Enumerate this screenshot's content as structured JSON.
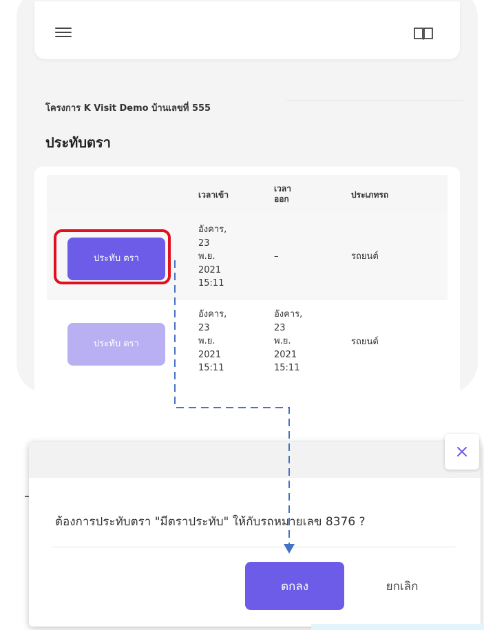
{
  "header": {
    "menu_icon": "hamburger-menu-icon",
    "book_icon": "open-book-icon"
  },
  "project": {
    "title": "โครงการ K Visit Demo บ้านเลขที่ 555"
  },
  "page": {
    "title": "ประทับตรา"
  },
  "table": {
    "columns": [
      "",
      "เวลาเข้า",
      "เวลา ออก",
      "ประเภทรถ"
    ],
    "rows": [
      {
        "action_label": "ประทับ ตรา",
        "enabled": true,
        "time_in": [
          "อังคาร,",
          "23",
          "พ.ย.",
          "2021",
          "15:11"
        ],
        "time_out": "–",
        "vehicle_type": "รถยนต์"
      },
      {
        "action_label": "ประทับ ตรา",
        "enabled": false,
        "time_in": [
          "อังคาร,",
          "23",
          "พ.ย.",
          "2021",
          "15:11"
        ],
        "time_out": [
          "อังคาร,",
          "23",
          "พ.ย.",
          "2021",
          "15:11"
        ],
        "vehicle_type": "รถยนต์"
      }
    ]
  },
  "dialog": {
    "message": "ต้องการประทับตรา \"มีตราประทับ\" ให้กับรถหมายเลข 8376 ?",
    "confirm_label": "ตกลง",
    "cancel_label": "ยกเลิก",
    "close_icon": "close-icon"
  },
  "colors": {
    "primary": "#6c5ce7",
    "primary_disabled": "#b8b0f2",
    "highlight": "#e0101e",
    "annotation_arrow": "#4472c4"
  }
}
